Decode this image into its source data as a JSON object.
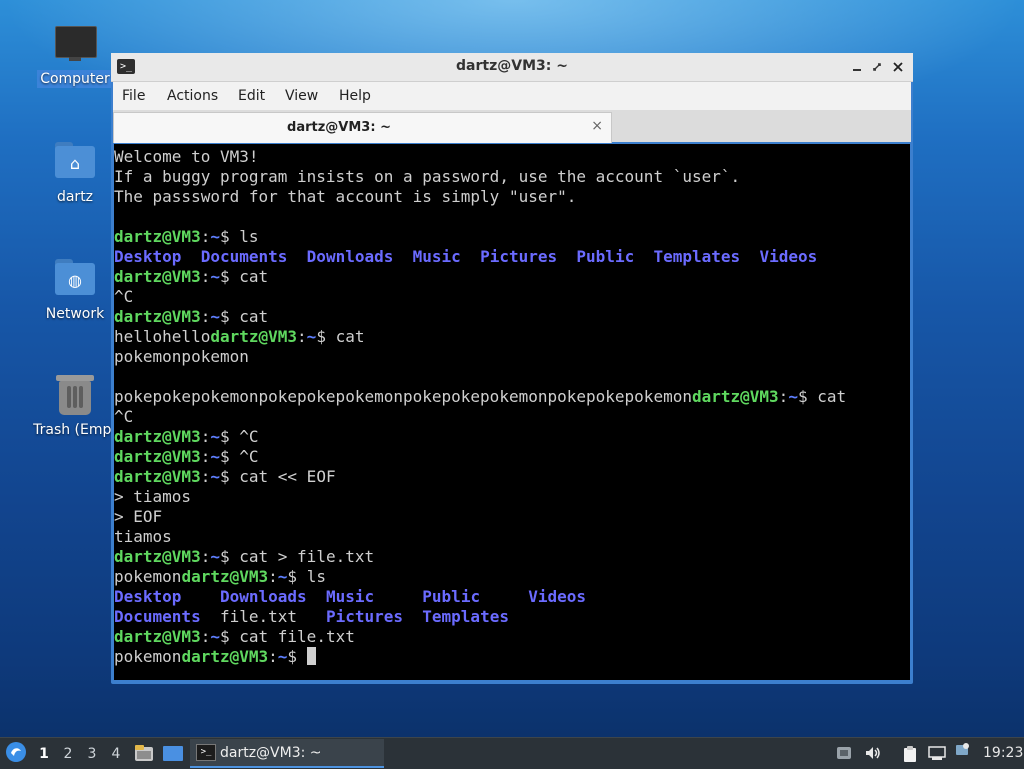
{
  "desktop": {
    "icons": [
      {
        "label": "Computer"
      },
      {
        "label": "dartz"
      },
      {
        "label": "Network"
      },
      {
        "label": "Trash (Empt"
      }
    ]
  },
  "window": {
    "title": "dartz@VM3: ~",
    "menu": [
      "File",
      "Actions",
      "Edit",
      "View",
      "Help"
    ],
    "tab_label": "dartz@VM3: ~",
    "tab_close": "×"
  },
  "terminal": {
    "prompt_user": "dartz@VM3",
    "prompt_path": "~",
    "lines": [
      [
        {
          "t": "Welcome to VM3!"
        }
      ],
      [
        {
          "t": "If a buggy program insists on a password, use the account `user`."
        }
      ],
      [
        {
          "t": "The passsword for that account is simply \"user\"."
        }
      ],
      [
        {
          "t": ""
        }
      ],
      [
        {
          "k": "user",
          "t": "dartz@VM3"
        },
        {
          "t": ":"
        },
        {
          "k": "path",
          "t": "~"
        },
        {
          "t": "$ ls"
        }
      ],
      [
        {
          "k": "dir",
          "t": "Desktop"
        },
        {
          "t": "  "
        },
        {
          "k": "dir",
          "t": "Documents"
        },
        {
          "t": "  "
        },
        {
          "k": "dir",
          "t": "Downloads"
        },
        {
          "t": "  "
        },
        {
          "k": "dir",
          "t": "Music"
        },
        {
          "t": "  "
        },
        {
          "k": "dir",
          "t": "Pictures"
        },
        {
          "t": "  "
        },
        {
          "k": "dir",
          "t": "Public"
        },
        {
          "t": "  "
        },
        {
          "k": "dir",
          "t": "Templates"
        },
        {
          "t": "  "
        },
        {
          "k": "dir",
          "t": "Videos"
        }
      ],
      [
        {
          "k": "user",
          "t": "dartz@VM3"
        },
        {
          "t": ":"
        },
        {
          "k": "path",
          "t": "~"
        },
        {
          "t": "$ cat"
        }
      ],
      [
        {
          "t": "^C"
        }
      ],
      [
        {
          "k": "user",
          "t": "dartz@VM3"
        },
        {
          "t": ":"
        },
        {
          "k": "path",
          "t": "~"
        },
        {
          "t": "$ cat"
        }
      ],
      [
        {
          "t": "hellohello"
        },
        {
          "k": "user",
          "t": "dartz@VM3"
        },
        {
          "t": ":"
        },
        {
          "k": "path",
          "t": "~"
        },
        {
          "t": "$ cat"
        }
      ],
      [
        {
          "t": "pokemonpokemon"
        }
      ],
      [
        {
          "t": ""
        }
      ],
      [
        {
          "t": "pokepokepokemonpokepokepokemonpokepokepokemonpokepokepokemon"
        },
        {
          "k": "user",
          "t": "dartz@VM3"
        },
        {
          "t": ":"
        },
        {
          "k": "path",
          "t": "~"
        },
        {
          "t": "$ cat"
        }
      ],
      [
        {
          "t": "^C"
        }
      ],
      [
        {
          "k": "user",
          "t": "dartz@VM3"
        },
        {
          "t": ":"
        },
        {
          "k": "path",
          "t": "~"
        },
        {
          "t": "$ ^C"
        }
      ],
      [
        {
          "k": "user",
          "t": "dartz@VM3"
        },
        {
          "t": ":"
        },
        {
          "k": "path",
          "t": "~"
        },
        {
          "t": "$ ^C"
        }
      ],
      [
        {
          "k": "user",
          "t": "dartz@VM3"
        },
        {
          "t": ":"
        },
        {
          "k": "path",
          "t": "~"
        },
        {
          "t": "$ cat << EOF"
        }
      ],
      [
        {
          "t": "> tiamos"
        }
      ],
      [
        {
          "t": "> EOF"
        }
      ],
      [
        {
          "t": "tiamos"
        }
      ],
      [
        {
          "k": "user",
          "t": "dartz@VM3"
        },
        {
          "t": ":"
        },
        {
          "k": "path",
          "t": "~"
        },
        {
          "t": "$ cat > file.txt"
        }
      ],
      [
        {
          "t": "pokemon"
        },
        {
          "k": "user",
          "t": "dartz@VM3"
        },
        {
          "t": ":"
        },
        {
          "k": "path",
          "t": "~"
        },
        {
          "t": "$ ls"
        }
      ],
      [
        {
          "k": "dir",
          "t": "Desktop"
        },
        {
          "t": "    "
        },
        {
          "k": "dir",
          "t": "Downloads"
        },
        {
          "t": "  "
        },
        {
          "k": "dir",
          "t": "Music"
        },
        {
          "t": "     "
        },
        {
          "k": "dir",
          "t": "Public"
        },
        {
          "t": "     "
        },
        {
          "k": "dir",
          "t": "Videos"
        }
      ],
      [
        {
          "k": "dir",
          "t": "Documents"
        },
        {
          "t": "  file.txt   "
        },
        {
          "k": "dir",
          "t": "Pictures"
        },
        {
          "t": "  "
        },
        {
          "k": "dir",
          "t": "Templates"
        }
      ],
      [
        {
          "k": "user",
          "t": "dartz@VM3"
        },
        {
          "t": ":"
        },
        {
          "k": "path",
          "t": "~"
        },
        {
          "t": "$ cat file.txt"
        }
      ],
      [
        {
          "t": "pokemon"
        },
        {
          "k": "user",
          "t": "dartz@VM3"
        },
        {
          "t": ":"
        },
        {
          "k": "path",
          "t": "~"
        },
        {
          "t": "$ "
        },
        {
          "k": "cursor",
          "t": ""
        }
      ]
    ]
  },
  "taskbar": {
    "workspaces": [
      "1",
      "2",
      "3",
      "4"
    ],
    "active_task_label": "dartz@VM3: ~",
    "clock": "19:23",
    "icons": [
      "start-menu-icon",
      "file-manager-icon",
      "show-desktop-icon",
      "terminal-icon",
      "volume-icon",
      "clipboard-icon",
      "network-icon",
      "update-notifier-icon"
    ]
  }
}
